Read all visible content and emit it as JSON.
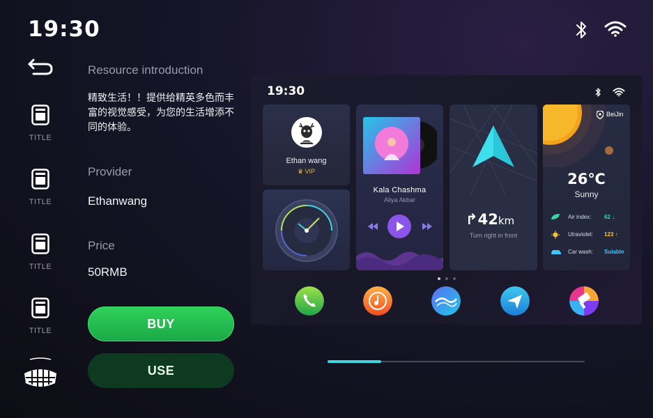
{
  "status_bar": {
    "time": "19:30",
    "icons": [
      "bluetooth-icon",
      "wifi-icon"
    ]
  },
  "sidebar": {
    "back_icon": "back-arrow-icon",
    "items": [
      {
        "label": "TITLE",
        "icon": "document-icon"
      },
      {
        "label": "TITLE",
        "icon": "document-icon"
      },
      {
        "label": "TITLE",
        "icon": "document-icon"
      },
      {
        "label": "TITLE",
        "icon": "document-icon"
      }
    ],
    "brand_icon": "brand-logo-icon"
  },
  "details": {
    "resource_label": "Resource introduction",
    "description": "精致生活！！提供给精英多色而丰富的视觉感受，为您的生活增添不同的体验。",
    "provider_label": "Provider",
    "provider_value": "Ethanwang",
    "price_label": "Price",
    "price_value": "50RMB",
    "buy_label": "BUY",
    "use_label": "USE"
  },
  "preview": {
    "time": "19:30",
    "user": {
      "name": "Ethan wang",
      "badge": "VIP"
    },
    "music": {
      "title": "Kala  Chashma",
      "artist": "Aliya  Akbar"
    },
    "navigation": {
      "distance_value": "42",
      "distance_unit": "km",
      "hint": "Turn right in front"
    },
    "weather": {
      "city": "BeiJin",
      "temperature": "26℃",
      "condition": "Sunny",
      "rows": [
        {
          "key": "Air index:",
          "value": "62",
          "trend": "↓",
          "color": "#35d6a2"
        },
        {
          "key": "Utraviolet:",
          "value": "123",
          "trend": "↑",
          "color": "#f4c13a"
        },
        {
          "key": "Car wash:",
          "value": "Suiable",
          "trend": "",
          "color": "#41c5ff"
        }
      ]
    },
    "page_dots": 3,
    "active_dot": 0,
    "dock": [
      "phone-icon",
      "music-icon",
      "browser-icon",
      "navigation-icon",
      "photos-icon"
    ]
  },
  "scroll": {
    "progress": 0.21
  },
  "colors": {
    "accent": "#3fd5e0",
    "buy": "#26c24f",
    "use": "#0f3a22"
  }
}
